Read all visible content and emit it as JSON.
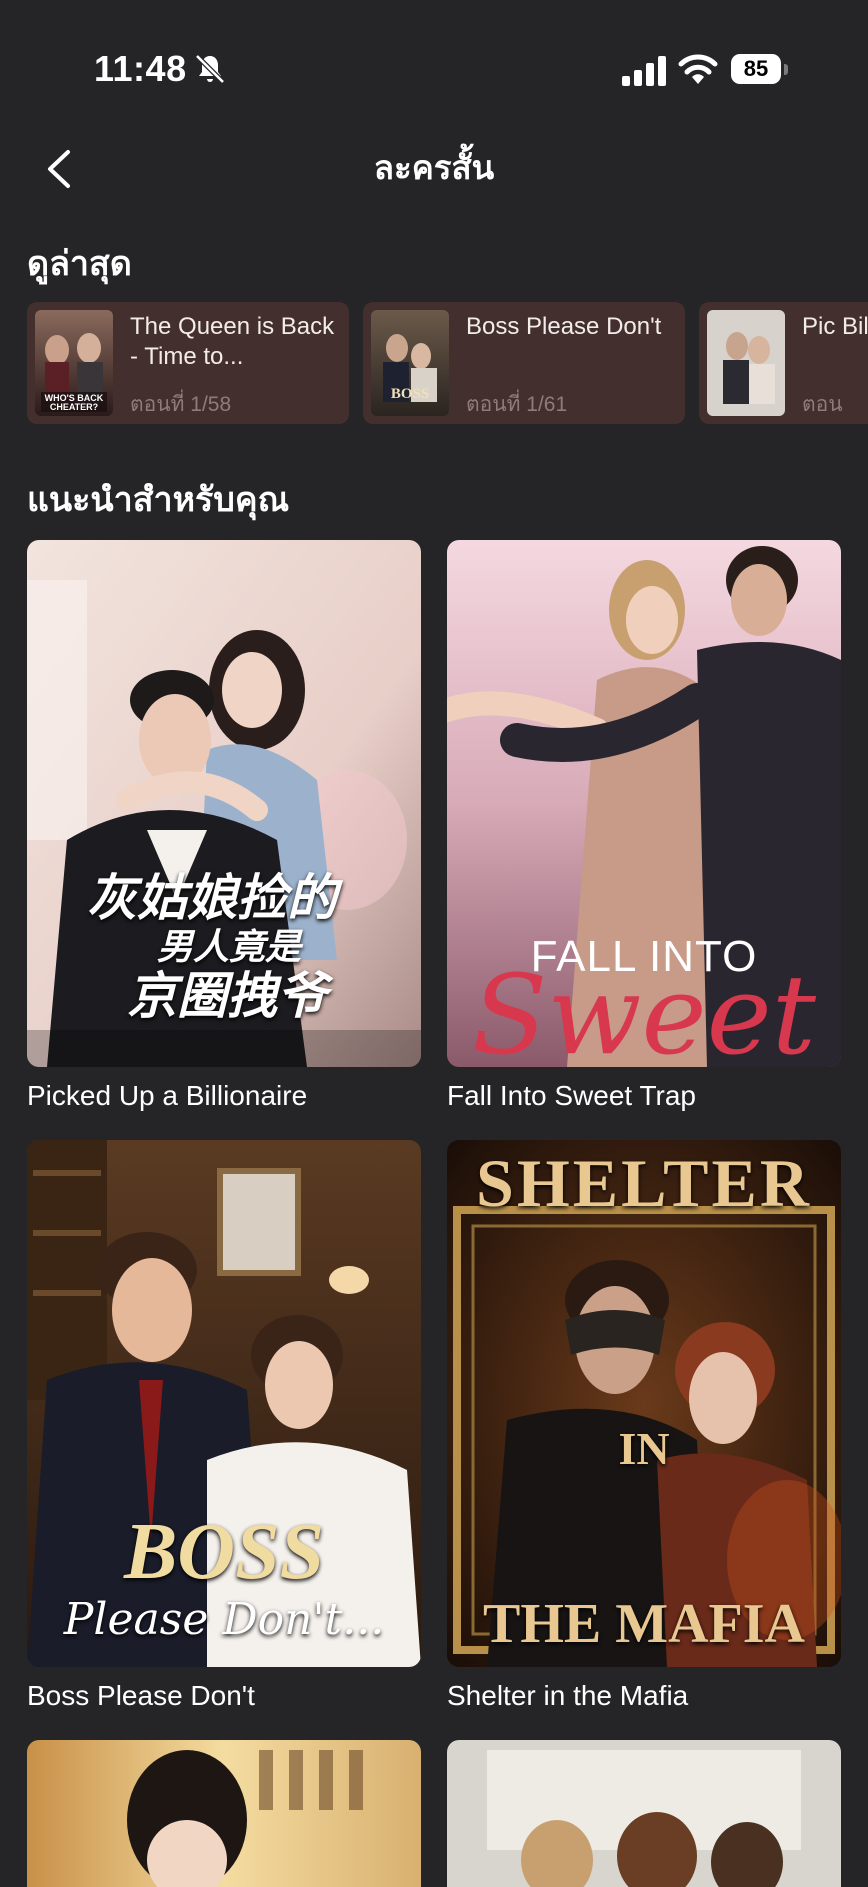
{
  "status": {
    "time": "11:48",
    "battery": "85"
  },
  "header": {
    "title": "ละครสั้น"
  },
  "recent": {
    "heading": "ดูล่าสุด",
    "items": [
      {
        "title": "The Queen is Back - Time to...",
        "episode": "ตอนที่ 1/58",
        "poster_text": "WHO'S BACK CHEATER?"
      },
      {
        "title": "Boss Please Don't",
        "episode": "ตอนที่ 1/61",
        "poster_text": "BOSS"
      },
      {
        "title": "Pic Billi",
        "episode": "ตอน"
      }
    ]
  },
  "recommend": {
    "heading": "แนะนำสำหรับคุณ",
    "items": [
      {
        "title": "Picked Up a Billionaire",
        "poster_text_1": "灰姑娘捡的",
        "poster_text_2": "男人竟是",
        "poster_text_3": "京圈拽爷"
      },
      {
        "title": "Fall Into Sweet Trap",
        "poster_text_1": "FALL INTO",
        "poster_text_2": "Sweet"
      },
      {
        "title": "Boss Please Don't",
        "poster_text_1": "BOSS",
        "poster_text_2": "Please Don't..."
      },
      {
        "title": "Shelter in the Mafia",
        "poster_text_1": "SHELTER",
        "poster_text_2": "IN",
        "poster_text_3": "THE MAFIA"
      }
    ]
  },
  "colors": {
    "background": "#252527",
    "recent_card": "#43302e",
    "recent_episode": "#8e7c79"
  }
}
